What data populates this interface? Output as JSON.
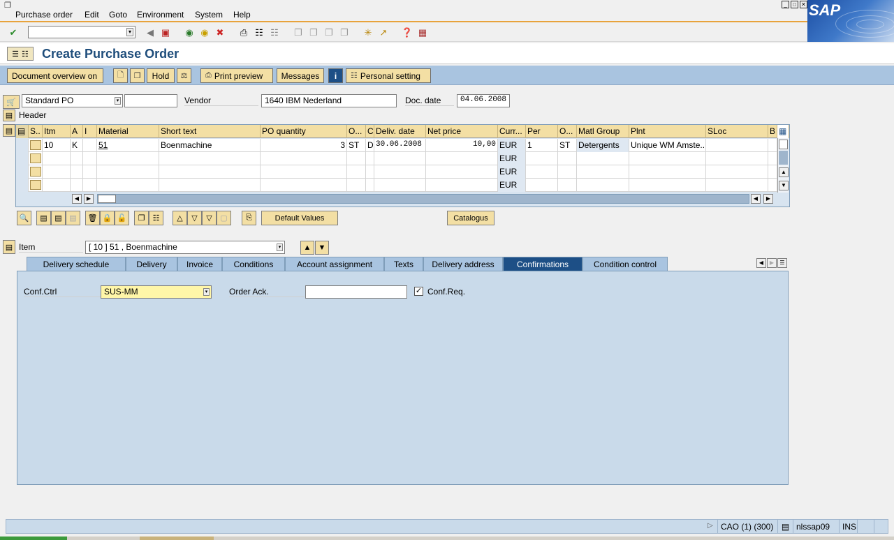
{
  "menu": {
    "items": [
      "Purchase order",
      "Edit",
      "Goto",
      "Environment",
      "System",
      "Help"
    ]
  },
  "logo": "SAP",
  "title": "Create Purchase Order",
  "app_toolbar": {
    "document_overview": "Document overview on",
    "hold": "Hold",
    "print_preview": "Print preview",
    "messages": "Messages",
    "personal_setting": "Personal setting"
  },
  "header": {
    "doc_type": "Standard PO",
    "doc_number": "",
    "vendor_label": "Vendor",
    "vendor": "1640 IBM Nederland",
    "doc_date_label": "Doc. date",
    "doc_date": "04.06.2008",
    "header_label": "Header"
  },
  "table": {
    "columns": [
      "S..",
      "Itm",
      "A",
      "I",
      "Material",
      "Short text",
      "PO quantity",
      "O...",
      "C",
      "Deliv. date",
      "Net price",
      "Curr...",
      "Per",
      "O...",
      "Matl Group",
      "Plnt",
      "SLoc",
      "B"
    ],
    "rows": [
      {
        "itm": "10",
        "a": "K",
        "i": "",
        "material": "51",
        "short_text": "Boenmachine",
        "qty": "3",
        "unit": "ST",
        "c": "D",
        "deliv_date": "30.06.2008",
        "net_price": "10,00",
        "curr": "EUR",
        "per": "1",
        "o": "ST",
        "matl_group": "Detergents",
        "plnt": "Unique WM Amste...",
        "sloc": ""
      },
      {
        "itm": "",
        "a": "",
        "i": "",
        "material": "",
        "short_text": "",
        "qty": "",
        "unit": "",
        "c": "",
        "deliv_date": "",
        "net_price": "",
        "curr": "EUR",
        "per": "",
        "o": "",
        "matl_group": "",
        "plnt": "",
        "sloc": ""
      },
      {
        "itm": "",
        "a": "",
        "i": "",
        "material": "",
        "short_text": "",
        "qty": "",
        "unit": "",
        "c": "",
        "deliv_date": "",
        "net_price": "",
        "curr": "EUR",
        "per": "",
        "o": "",
        "matl_group": "",
        "plnt": "",
        "sloc": ""
      },
      {
        "itm": "",
        "a": "",
        "i": "",
        "material": "",
        "short_text": "",
        "qty": "",
        "unit": "",
        "c": "",
        "deliv_date": "",
        "net_price": "",
        "curr": "EUR",
        "per": "",
        "o": "",
        "matl_group": "",
        "plnt": "",
        "sloc": ""
      }
    ]
  },
  "item_toolbar": {
    "default_values": "Default Values",
    "catalogue": "Catalogus"
  },
  "item": {
    "label": "Item",
    "selected": "[ 10 ] 51 , Boenmachine"
  },
  "tabs": [
    "Delivery schedule",
    "Delivery",
    "Invoice",
    "Conditions",
    "Account assignment",
    "Texts",
    "Delivery address",
    "Confirmations",
    "Condition control"
  ],
  "active_tab": "Confirmations",
  "confirmations": {
    "conf_ctrl_label": "Conf.Ctrl",
    "conf_ctrl_value": "SUS-MM",
    "order_ack_label": "Order Ack.",
    "order_ack_value": "",
    "conf_req_label": "Conf.Req.",
    "conf_req_checked": true
  },
  "status": {
    "system": "CAO (1) (300)",
    "server": "nlssap09",
    "mode": "INS"
  }
}
